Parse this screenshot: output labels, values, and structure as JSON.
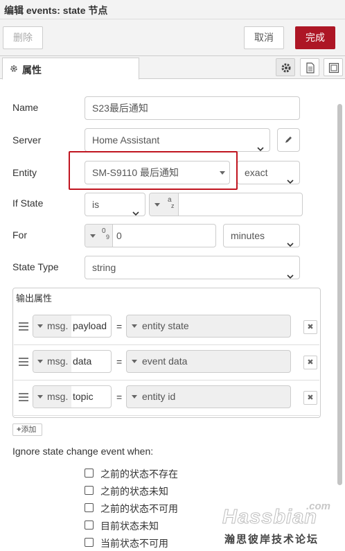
{
  "title": "编辑 events: state 节点",
  "toolbar": {
    "delete_label": "删除",
    "cancel_label": "取消",
    "done_label": "完成"
  },
  "tabs": {
    "properties_label": "属性",
    "icons": [
      "gear-icon",
      "document-icon",
      "frame-icon"
    ]
  },
  "form": {
    "name": {
      "label": "Name",
      "value": "S23最后通知"
    },
    "server": {
      "label": "Server",
      "value": "Home Assistant"
    },
    "entity": {
      "label": "Entity",
      "value": "SM-S9110 最后通知",
      "match": "exact"
    },
    "if_state": {
      "label": "If State",
      "operator": "is",
      "type_symbol": "a",
      "type_sub": "z",
      "value": ""
    },
    "for": {
      "label": "For",
      "type_symbol": "0",
      "type_sub": "9",
      "value": "0",
      "unit": "minutes"
    },
    "state_type": {
      "label": "State Type",
      "value": "string"
    }
  },
  "output": {
    "legend": "输出属性",
    "rows": [
      {
        "prefix": "msg.",
        "property": "payload",
        "equals": "=",
        "value": "entity state",
        "remove": "✖"
      },
      {
        "prefix": "msg.",
        "property": "data",
        "equals": "=",
        "value": "event data",
        "remove": "✖"
      },
      {
        "prefix": "msg.",
        "property": "topic",
        "equals": "=",
        "value": "entity id",
        "remove": "✖"
      }
    ],
    "add_label": "添加"
  },
  "ignore": {
    "heading": "Ignore state change event when:",
    "options": [
      "之前的状态不存在",
      "之前的状态未知",
      "之前的状态不可用",
      "目前状态未知",
      "当前状态不可用"
    ]
  },
  "watermark": {
    "brand": "Hassbian",
    "suffix": ".com",
    "tagline": "瀚思彼岸技术论坛"
  },
  "colors": {
    "accent": "#ad1625",
    "highlight": "#c0141f"
  }
}
